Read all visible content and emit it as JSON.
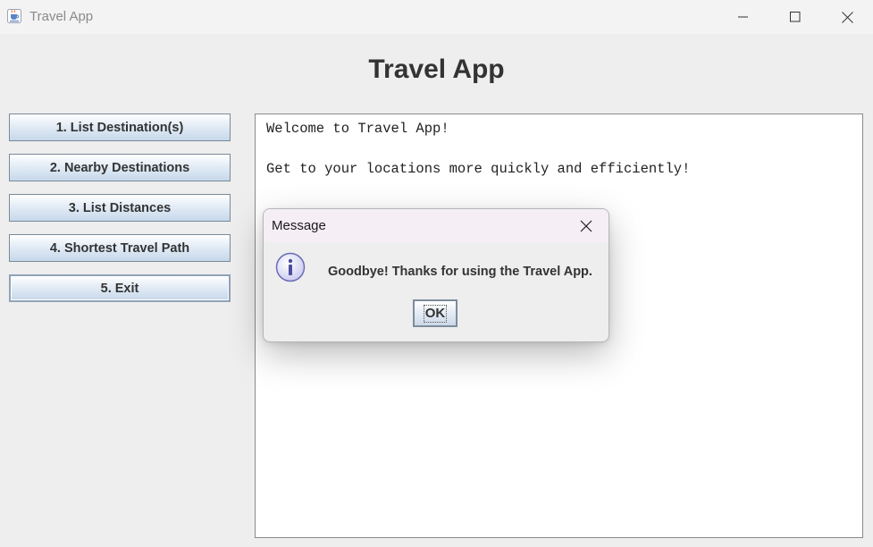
{
  "window": {
    "title": "Travel App",
    "icon": "java-cup-icon",
    "controls": [
      "minimize-icon",
      "maximize-icon",
      "close-icon"
    ]
  },
  "header": {
    "title": "Travel App"
  },
  "menu": {
    "items": [
      {
        "label": "1. List Destination(s)"
      },
      {
        "label": "2. Nearby Destinations"
      },
      {
        "label": "3. List Distances"
      },
      {
        "label": "4. Shortest Travel Path"
      },
      {
        "label": "5. Exit",
        "focused": true
      }
    ]
  },
  "output": {
    "text": "Welcome to Travel App!\n\nGet to your locations more quickly and efficiently!"
  },
  "dialog": {
    "title": "Message",
    "icon": "information-icon",
    "message": "Goodbye! Thanks for using the Travel App.",
    "ok_label": "OK"
  },
  "colors": {
    "window_bg": "#eeeeee",
    "button_gradient_top": "#ffffff",
    "button_gradient_bottom": "#c6d8ea",
    "dialog_titlebar_bg": "#f5eef5",
    "info_icon_fill": "#d8d8f2",
    "info_icon_stroke": "#6b6bb8"
  }
}
